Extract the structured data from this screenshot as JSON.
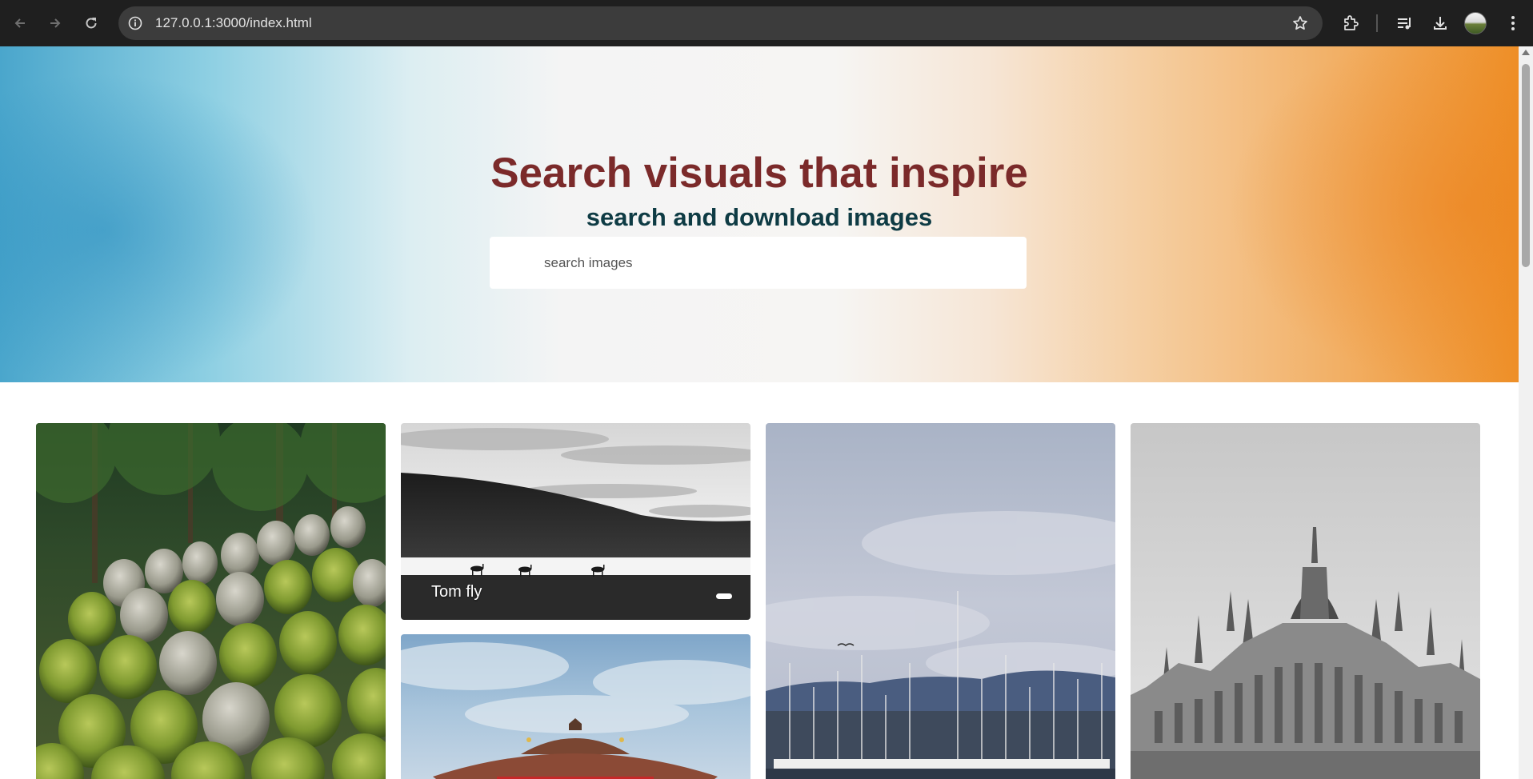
{
  "browser": {
    "url": "127.0.0.1:3000/index.html"
  },
  "hero": {
    "title": "Search visuals that inspire",
    "subtitle": "search and download images",
    "search_placeholder": "search images"
  },
  "gallery": {
    "cards": [
      {
        "subject": "moss-covered stone statues",
        "caption": ""
      },
      {
        "subject": "black and white antelope on plain",
        "caption": "Tom fly"
      },
      {
        "subject": "red pagoda roof under clouds",
        "caption": ""
      },
      {
        "subject": "marina with sailboat masts",
        "caption": ""
      },
      {
        "subject": "gothic parliament building black and white",
        "caption": ""
      }
    ]
  }
}
